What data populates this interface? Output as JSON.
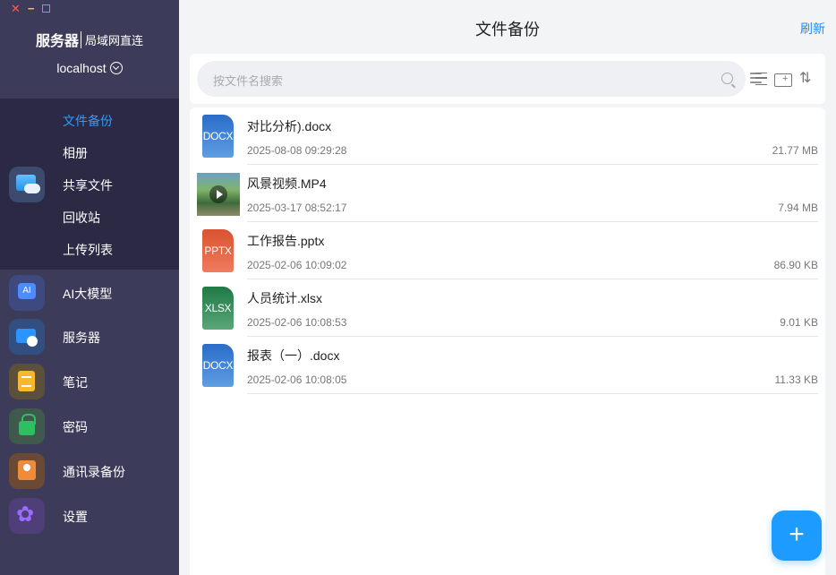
{
  "window": {
    "close_glyph": "✕",
    "min_glyph": "−"
  },
  "sidebar": {
    "server_title": "服务器",
    "server_subtitle": "局域网直连",
    "host": "localhost",
    "share_sub_items": [
      {
        "label": "文件备份",
        "active": true
      },
      {
        "label": "相册",
        "active": false
      },
      {
        "label": "共享文件",
        "active": false
      },
      {
        "label": "回收站",
        "active": false
      },
      {
        "label": "上传列表",
        "active": false
      }
    ],
    "nav": [
      {
        "label": "AI大模型",
        "icon": "ai-model-icon"
      },
      {
        "label": "服务器",
        "icon": "server-icon"
      },
      {
        "label": "笔记",
        "icon": "note-icon"
      },
      {
        "label": "密码",
        "icon": "password-lock-icon"
      },
      {
        "label": "通讯录备份",
        "icon": "contacts-backup-icon"
      },
      {
        "label": "设置",
        "icon": "settings-icon"
      }
    ]
  },
  "header": {
    "title": "文件备份",
    "refresh_label": "刷新"
  },
  "search": {
    "placeholder": "按文件名搜索"
  },
  "files": [
    {
      "name": "对比分析).docx",
      "date": "2025-08-08 09:29:28",
      "size": "21.77 MB",
      "type": "DOCX"
    },
    {
      "name": "风景视频.MP4",
      "date": "2025-03-17 08:52:17",
      "size": "7.94 MB",
      "type": "MP4"
    },
    {
      "name": "工作报告.pptx",
      "date": "2025-02-06 10:09:02",
      "size": "86.90 KB",
      "type": "PPTX"
    },
    {
      "name": "人员统计.xlsx",
      "date": "2025-02-06 10:08:53",
      "size": "9.01 KB",
      "type": "XLSX"
    },
    {
      "name": "报表（一）.docx",
      "date": "2025-02-06 10:08:05",
      "size": "11.33 KB",
      "type": "DOCX"
    }
  ],
  "fab_label": "+",
  "colors": {
    "accent": "#1e9bff",
    "sidebar_bg": "#3d3b5a",
    "sidebar_group_bg": "#2b2944",
    "active_text": "#2e9bff"
  }
}
